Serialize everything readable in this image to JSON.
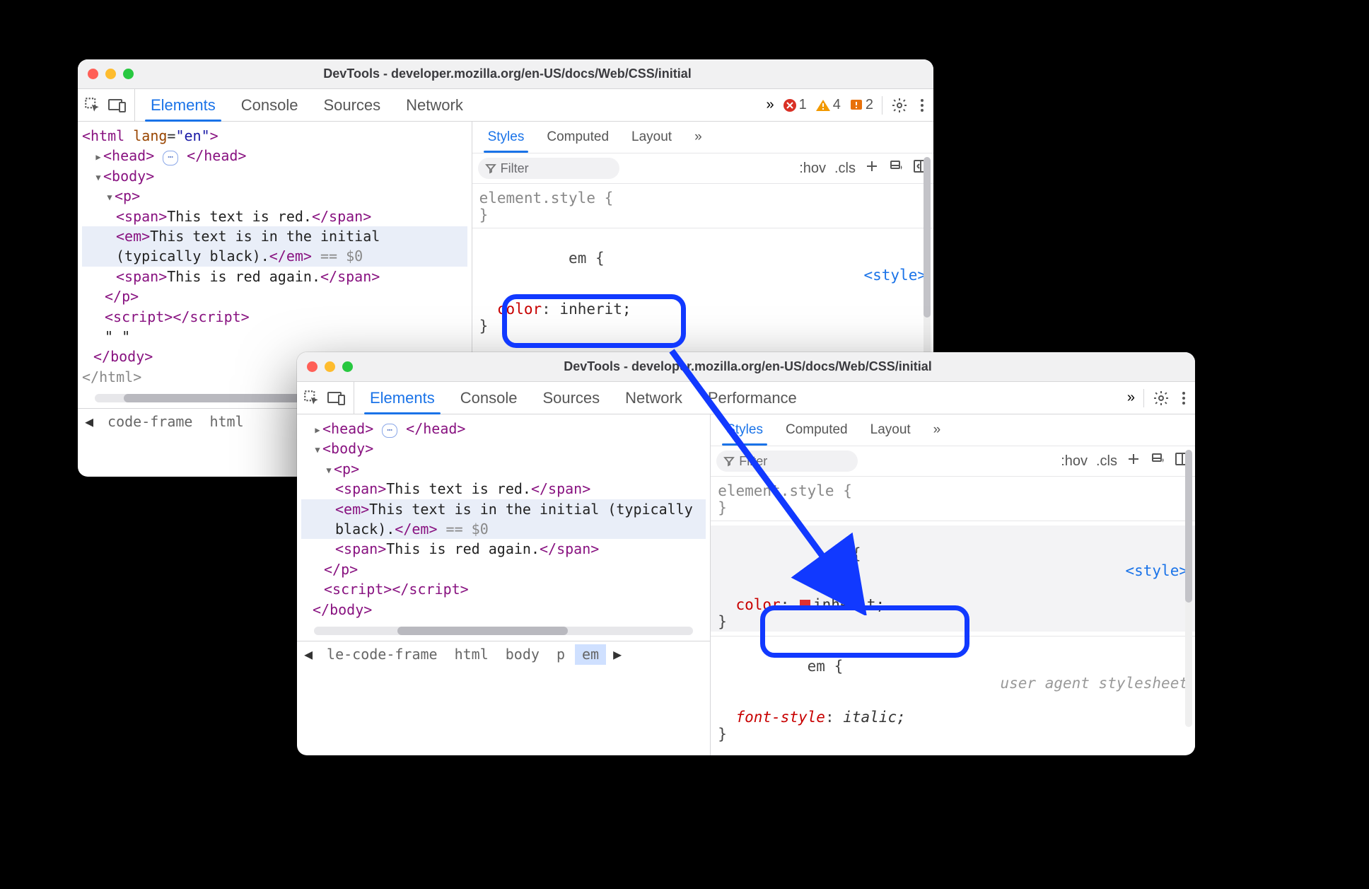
{
  "colors": {
    "accent": "#1a73e8",
    "highlight_ring": "#1139ff",
    "tag": "#881280",
    "prop": "#c80000"
  },
  "window_a": {
    "title": "DevTools - developer.mozilla.org/en-US/docs/Web/CSS/initial",
    "tabs": [
      "Elements",
      "Console",
      "Sources",
      "Network"
    ],
    "overflow": "»",
    "badges": {
      "errors": "1",
      "warnings": "4",
      "issues": "2"
    },
    "dom": {
      "html_open": "<html lang=\"en\">",
      "head": {
        "open": "<head>",
        "ell": "⋯",
        "close": "</head>"
      },
      "body_open": "<body>",
      "p_open": "<p>",
      "span1": {
        "open": "<span>",
        "text": "This text is red.",
        "close": "</span>"
      },
      "em": {
        "open": "<em>",
        "text": "This text is in the initial (typically black).",
        "close": "</em>",
        "trail": " == $0"
      },
      "span2": {
        "open": "<span>",
        "text": "This is red again.",
        "close": "</span>"
      },
      "p_close": "</p>",
      "script": "<script></script>",
      "quote": "\" \"",
      "body_close": "</body>",
      "html_close": "</html>"
    },
    "crumbs": [
      "code-frame",
      "html"
    ],
    "right": {
      "subtabs": [
        "Styles",
        "Computed",
        "Layout"
      ],
      "overflow": "»",
      "filter_label": "Filter",
      "hov": ":hov",
      "cls": ".cls",
      "rule_element": "element.style {",
      "rule_element_close": "}",
      "rule_em_open": "em {",
      "rule_em_src": "<style>",
      "rule_em_prop": "color",
      "rule_em_val": "inherit;",
      "rule_em_close": "}"
    }
  },
  "window_b": {
    "title": "DevTools - developer.mozilla.org/en-US/docs/Web/CSS/initial",
    "tabs": [
      "Elements",
      "Console",
      "Sources",
      "Network",
      "Performance"
    ],
    "overflow": "»",
    "dom": {
      "head": {
        "open": "<head>",
        "ell": "⋯",
        "close": "</head>"
      },
      "body_open": "<body>",
      "p_open": "<p>",
      "span1": {
        "open": "<span>",
        "text": "This text is red.",
        "close": "</span>"
      },
      "em": {
        "open": "<em>",
        "text": "This text is in the initial (typically black).",
        "close": "</em>",
        "trail": " == $0"
      },
      "span2": {
        "open": "<span>",
        "text": "This is red again.",
        "close": "</span>"
      },
      "p_close": "</p>",
      "script": "<script></script>",
      "body_close": "</body>"
    },
    "crumbs": [
      "le-code-frame",
      "html",
      "body",
      "p",
      "em"
    ],
    "right": {
      "subtabs": [
        "Styles",
        "Computed",
        "Layout"
      ],
      "overflow": "»",
      "filter_label": "Filter",
      "hov": ":hov",
      "cls": ".cls",
      "rule_element": "element.style {",
      "rule_element_close": "}",
      "rule_em_open": "em {",
      "rule_em_src": "<style>",
      "rule_em_prop": "color",
      "rule_em_val": "inherit;",
      "rule_em_close": "}",
      "rule_ua_open": "em {",
      "rule_ua_src": "user agent stylesheet",
      "rule_ua_prop": "font-style",
      "rule_ua_val": "italic;",
      "rule_ua_close": "}"
    }
  }
}
